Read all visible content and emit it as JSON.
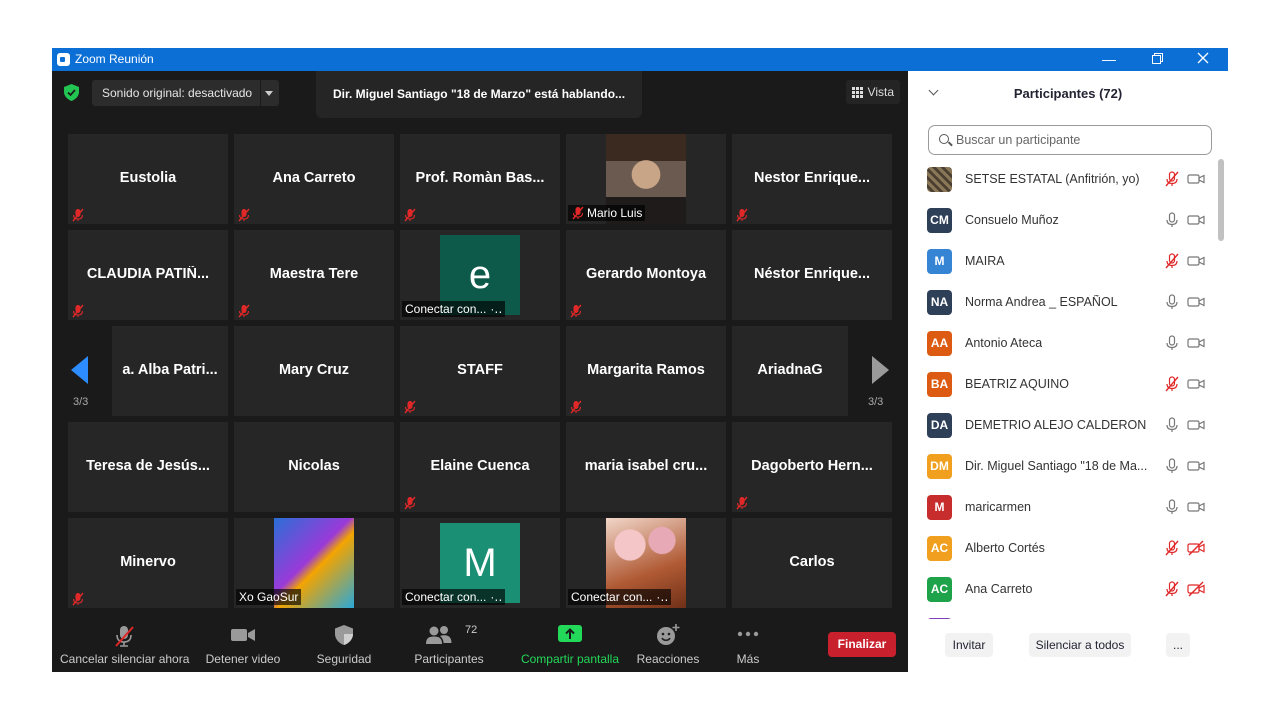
{
  "window": {
    "title": "Zoom Reunión"
  },
  "topbar": {
    "sound_label": "Sonido original: desactivado",
    "speaking": "Dir. Miguel Santiago \"18 de Marzo\" está hablando...",
    "view_label": "Vista"
  },
  "grid": {
    "page_left": "3/3",
    "page_right": "3/3",
    "tiles": [
      {
        "name": "Eustolia"
      },
      {
        "name": "Ana Carreto"
      },
      {
        "name": "Prof. Romàn Bas..."
      },
      {
        "name": "Mario Luis"
      },
      {
        "name": "Nestor  Enrique..."
      },
      {
        "name": "CLAUDIA  PATIÑ..."
      },
      {
        "name": "Maestra Tere"
      },
      {
        "name": "Conectar con...",
        "avatar": "e"
      },
      {
        "name": "Gerardo Montoya"
      },
      {
        "name": "Néstor  Enrique..."
      },
      {
        "name": "a.  Alba  Patri..."
      },
      {
        "name": "Mary Cruz"
      },
      {
        "name": "STAFF"
      },
      {
        "name": "Margarita Ramos"
      },
      {
        "name": "AriadnaG"
      },
      {
        "name": "Teresa de Jesús..."
      },
      {
        "name": "Nicolas"
      },
      {
        "name": "Elaine Cuenca"
      },
      {
        "name": "maria  isabel  cru..."
      },
      {
        "name": "Dagoberto  Hern..."
      },
      {
        "name": "Minervo"
      },
      {
        "name": "Xo GaoSur"
      },
      {
        "name": "Conectar con...",
        "avatar": "M"
      },
      {
        "name": "Conectar con..."
      },
      {
        "name": "Carlos"
      }
    ]
  },
  "toolbar": {
    "mute": "Cancelar silenciar ahora",
    "video": "Detener video",
    "security": "Seguridad",
    "participants": "Participantes",
    "participants_count": "72",
    "share": "Compartir pantalla",
    "reactions": "Reacciones",
    "more": "Más",
    "end": "Finalizar"
  },
  "panel": {
    "title": "Participantes (72)",
    "search_placeholder": "Buscar un participante",
    "participants": [
      {
        "initials": "",
        "name": "SETSE ESTATAL (Anfitrión, yo)",
        "color": "#6b5a43",
        "mic": "muted",
        "cam": "off"
      },
      {
        "initials": "CM",
        "name": "Consuelo Muñoz",
        "color": "#2e3f58",
        "mic": "on",
        "cam": "off"
      },
      {
        "initials": "M",
        "name": "MAIRA",
        "color": "#3585d4",
        "mic": "muted",
        "cam": "off"
      },
      {
        "initials": "NA",
        "name": "Norma Andrea _ ESPAÑOL",
        "color": "#2e3f58",
        "mic": "on",
        "cam": "off"
      },
      {
        "initials": "AA",
        "name": "Antonio Ateca",
        "color": "#dd5a12",
        "mic": "on",
        "cam": "off"
      },
      {
        "initials": "BA",
        "name": "BEATRIZ AQUINO",
        "color": "#dd5a12",
        "mic": "muted",
        "cam": "off"
      },
      {
        "initials": "DA",
        "name": "DEMETRIO ALEJO CALDERON",
        "color": "#2e3f58",
        "mic": "on",
        "cam": "off"
      },
      {
        "initials": "DM",
        "name": "Dir. Miguel Santiago \"18 de Ma...",
        "color": "#f0a01e",
        "mic": "on",
        "cam": "off"
      },
      {
        "initials": "M",
        "name": "maricarmen",
        "color": "#c82d2d",
        "mic": "on",
        "cam": "off"
      },
      {
        "initials": "AC",
        "name": "Alberto Cortés",
        "color": "#f0a01e",
        "mic": "muted",
        "cam": "blocked"
      },
      {
        "initials": "AC",
        "name": "Ana Carreto",
        "color": "#1fa34a",
        "mic": "muted",
        "cam": "blocked"
      }
    ],
    "invite": "Invitar",
    "mute_all": "Silenciar a todos",
    "more": "..."
  },
  "colors": {
    "accent": "#0b6fd6",
    "nav_arrow": "#2d8cff",
    "end_button": "#c8202c",
    "share_green": "#23d959",
    "mute_red": "#e02828"
  }
}
